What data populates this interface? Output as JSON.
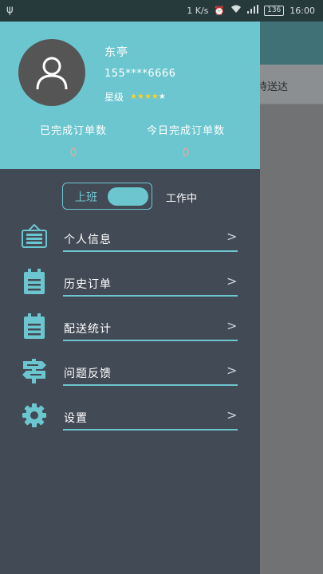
{
  "status_bar": {
    "speed": "1 K/s",
    "battery": "136",
    "time": "16:00"
  },
  "background": {
    "tab_text": "待送达"
  },
  "drawer": {
    "user": {
      "name": "东亭",
      "phone": "155****6666",
      "level_label": "星级",
      "stars_filled": 4,
      "stars_total": 5
    },
    "stats": [
      {
        "label": "已完成订单数",
        "value": "0"
      },
      {
        "label": "今日完成订单数",
        "value": "0"
      }
    ],
    "work_toggle": {
      "left_label": "上班",
      "status": "工作中"
    },
    "menu": [
      {
        "label": "个人信息",
        "icon": "id-card-icon"
      },
      {
        "label": "历史订单",
        "icon": "clipboard-icon"
      },
      {
        "label": "配送统计",
        "icon": "clipboard-icon"
      },
      {
        "label": "问题反馈",
        "icon": "signpost-icon"
      },
      {
        "label": "设置",
        "icon": "gear-icon"
      }
    ],
    "chevron": ">"
  },
  "colors": {
    "accent": "#6cc6cf",
    "drawer_bg": "#424a55",
    "stat_value": "#f4a590",
    "star": "#ffd21f"
  }
}
